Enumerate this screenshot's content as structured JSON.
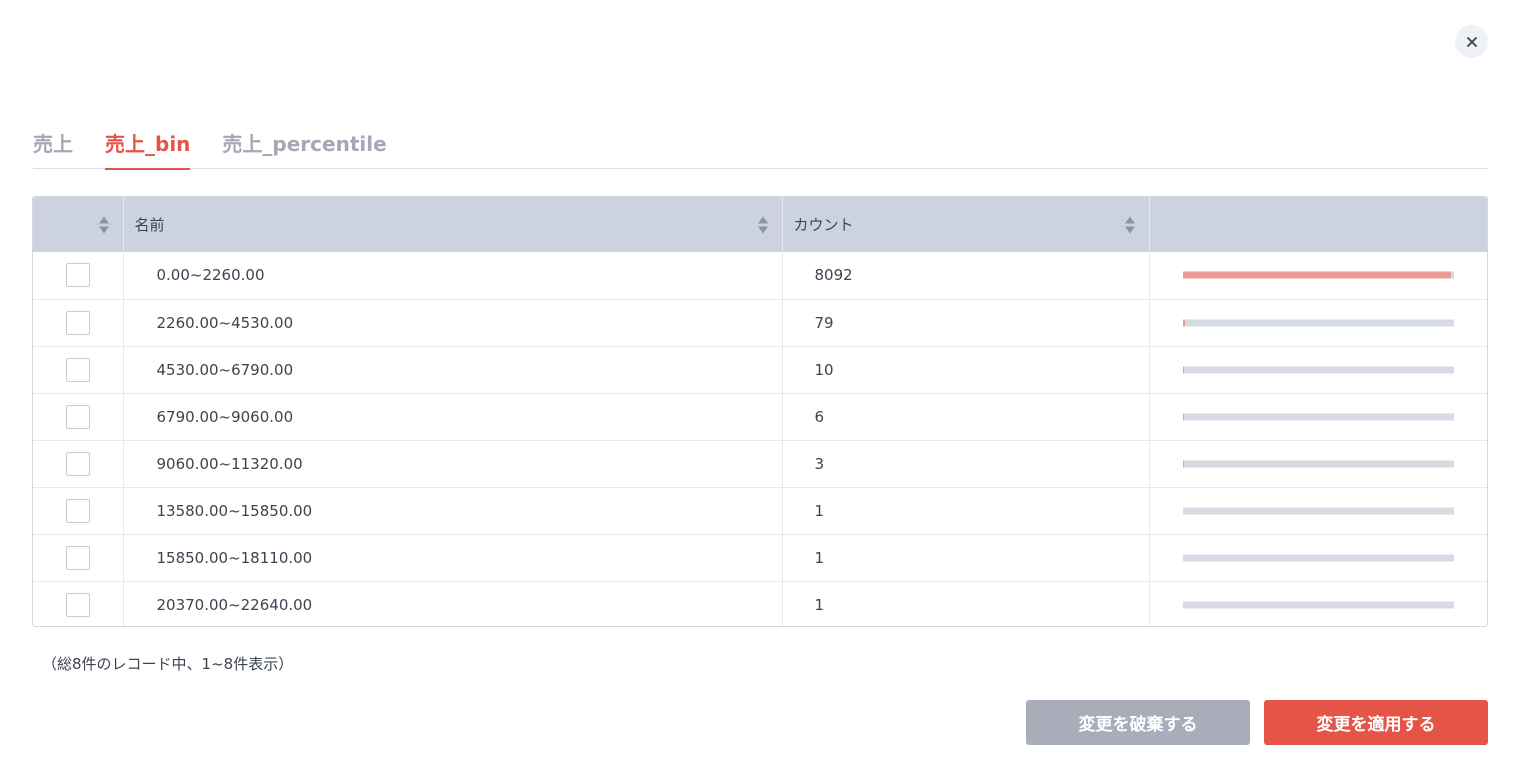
{
  "tabs": [
    {
      "label": "売上",
      "active": false
    },
    {
      "label": "売上_bin",
      "active": true
    },
    {
      "label": "売上_percentile",
      "active": false
    }
  ],
  "table": {
    "columns": [
      "",
      "名前",
      "カウント",
      ""
    ],
    "rows": [
      {
        "name": "0.00~2260.00",
        "count": "8092",
        "fraction": 0.99
      },
      {
        "name": "2260.00~4530.00",
        "count": "79",
        "fraction": 0.0097
      },
      {
        "name": "4530.00~6790.00",
        "count": "10",
        "fraction": 0.0012
      },
      {
        "name": "6790.00~9060.00",
        "count": "6",
        "fraction": 0.0007
      },
      {
        "name": "9060.00~11320.00",
        "count": "3",
        "fraction": 0.0004
      },
      {
        "name": "13580.00~15850.00",
        "count": "1",
        "fraction": 0.0001
      },
      {
        "name": "15850.00~18110.00",
        "count": "1",
        "fraction": 0.0001
      },
      {
        "name": "20370.00~22640.00",
        "count": "1",
        "fraction": 0.0001
      }
    ]
  },
  "footer": {
    "summary": "（総8件のレコード中、1~8件表示）"
  },
  "buttons": {
    "discard": "変更を破棄する",
    "apply": "変更を適用する"
  },
  "colors": {
    "accent": "#e45548",
    "bar_fill": "#e89b97",
    "bar_track": "#d6dbe3",
    "header_bg": "#cdd3de"
  },
  "icons": {
    "close": "close-icon",
    "sort": "sort-icon"
  }
}
